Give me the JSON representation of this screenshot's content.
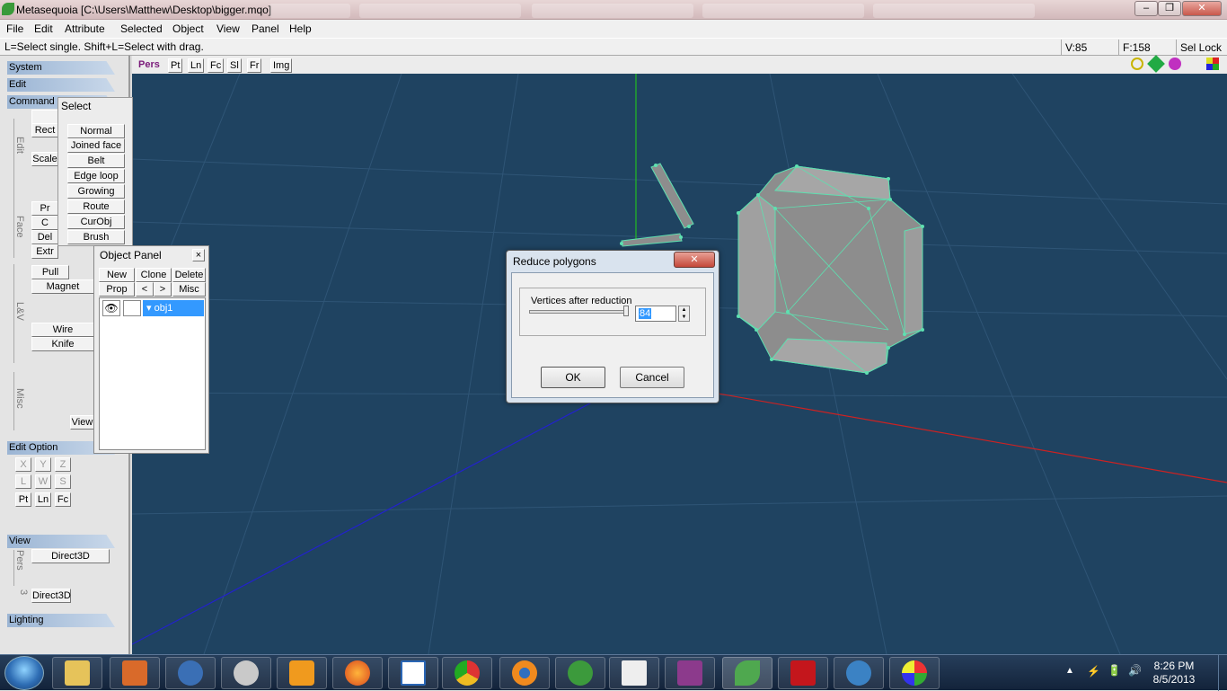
{
  "window": {
    "title": "Metasequoia [C:\\Users\\Matthew\\Desktop\\bigger.mqo]",
    "minimize": "–",
    "maximize": "❐",
    "close": "✕"
  },
  "menu": [
    "File",
    "Edit",
    "Attribute",
    "Selected",
    "Object",
    "View",
    "Panel",
    "Help"
  ],
  "status": {
    "hint": "L=Select single.  Shift+L=Select with drag.",
    "vertices": "V:85",
    "faces": "F:158",
    "sel_lock": "Sel Lock"
  },
  "left_panel": {
    "system": "System",
    "edit": "Edit",
    "command": "Command",
    "cmd_buttons": {
      "rect": "Rect",
      "scale": "Scale",
      "p": "Pr",
      "c": "C",
      "del": "Del",
      "extr": "Extr",
      "pull": "Pull",
      "magnet": "Magnet",
      "wire": "Wire",
      "knife": "Knife",
      "view": "View"
    },
    "groups": {
      "edit": "Edit",
      "face": "Face",
      "lav": "L&V",
      "misc": "Misc"
    },
    "edit_option": "Edit Option",
    "axes": [
      "X",
      "Y",
      "Z"
    ],
    "lws": [
      "L",
      "W",
      "S"
    ],
    "modes": [
      "Pt",
      "Ln",
      "Fc"
    ],
    "view": "View",
    "view_group": "Pers",
    "direct3d_1": "Direct3D",
    "three": "3",
    "direct3d_2": "Direct3D",
    "lighting": "Lighting"
  },
  "viewport_toolbar": {
    "buttons": [
      "Pers",
      "Pt",
      "Ln",
      "Fc",
      "Sl",
      "Fr",
      "Img"
    ]
  },
  "select_panel": {
    "title": "Select",
    "items": [
      "Normal",
      "Joined face",
      "Belt",
      "Edge loop",
      "Growing",
      "Route",
      "CurObj",
      "Brush"
    ]
  },
  "object_panel": {
    "title": "Object Panel",
    "close": "×",
    "row1": [
      "New",
      "Clone",
      "Delete"
    ],
    "row2": [
      "Prop",
      "<",
      ">",
      "Misc"
    ],
    "object_name": "obj1"
  },
  "dialog": {
    "title": "Reduce polygons",
    "close": "✕",
    "label": "Vertices after reduction",
    "value": "84",
    "ok": "OK",
    "cancel": "Cancel",
    "spin_up": "▲",
    "spin_down": "▼"
  },
  "taskbar": {
    "time": "8:26 PM",
    "date": "8/5/2013",
    "tray": [
      "▲",
      "⚡",
      "🔋",
      "🔊"
    ]
  },
  "colors": {
    "viewport": "#1f4361",
    "mesh": "#8d8d8d",
    "mesh_edge": "#5ee0b0",
    "x_axis": "#cc2222",
    "y_axis": "#22bb22",
    "z_axis": "#2222cc"
  }
}
